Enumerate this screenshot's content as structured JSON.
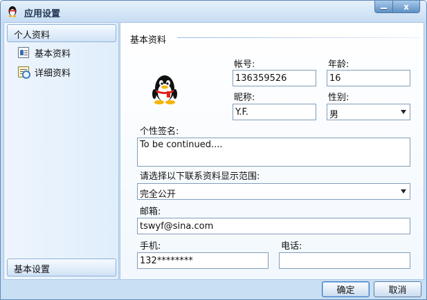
{
  "window": {
    "title": "应用设置"
  },
  "win_controls": {
    "minimize": "–",
    "close": "x"
  },
  "sidebar": {
    "group_personal": "个人资料",
    "items": [
      {
        "label": "基本资料",
        "icon": "id-card-icon"
      },
      {
        "label": "详细资料",
        "icon": "detail-doc-icon"
      }
    ],
    "group_basic_settings": "基本设置"
  },
  "content": {
    "section_title": "基本资料",
    "account": {
      "label": "帐号:",
      "value": "136359526"
    },
    "age": {
      "label": "年龄:",
      "value": "16"
    },
    "nickname": {
      "label": "昵称:",
      "value": "Y.F."
    },
    "gender": {
      "label": "性别:",
      "value": "男"
    },
    "signature": {
      "label": "个性签名:",
      "value": "To be continued...."
    },
    "visibility": {
      "label": "请选择以下联系资料显示范围:",
      "value": "完全公开"
    },
    "email": {
      "label": "邮箱:",
      "value": "tswyf@sina.com"
    },
    "mobile": {
      "label": "手机:",
      "value": "132********"
    },
    "phone": {
      "label": "电话:",
      "value": ""
    }
  },
  "buttons": {
    "ok": "确定",
    "cancel": "取消"
  },
  "colors": {
    "frame": "#c9dff3",
    "accent": "#5d88b5",
    "penguin_scarf": "#e02020",
    "penguin_feet": "#f5b400"
  }
}
